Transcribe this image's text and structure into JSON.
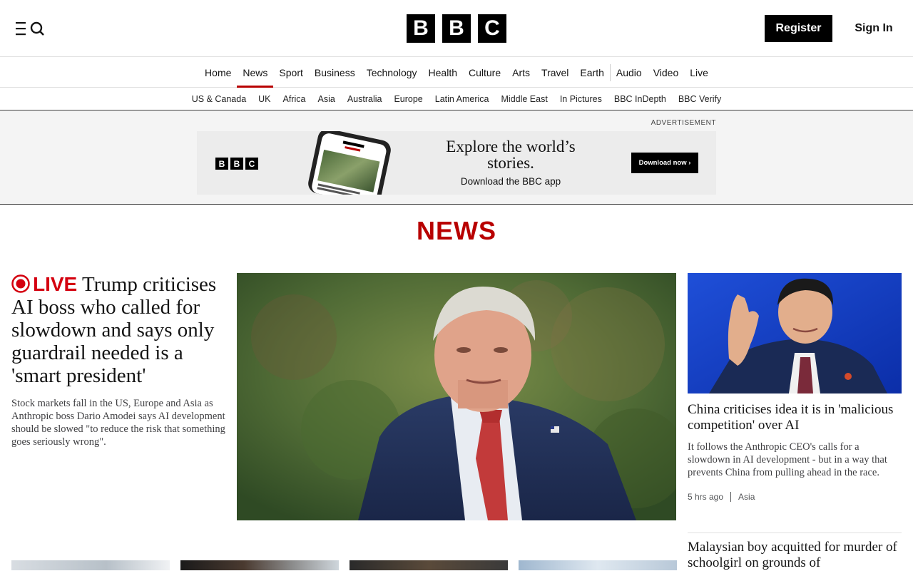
{
  "header": {
    "logo_letters": [
      "B",
      "B",
      "C"
    ],
    "register_label": "Register",
    "signin_label": "Sign In"
  },
  "main_nav": [
    {
      "label": "Home"
    },
    {
      "label": "News",
      "active": true
    },
    {
      "label": "Sport"
    },
    {
      "label": "Business"
    },
    {
      "label": "Technology"
    },
    {
      "label": "Health"
    },
    {
      "label": "Culture"
    },
    {
      "label": "Arts"
    },
    {
      "label": "Travel"
    },
    {
      "label": "Earth"
    },
    {
      "label": "Audio"
    },
    {
      "label": "Video"
    },
    {
      "label": "Live"
    }
  ],
  "sub_nav": [
    "US & Canada",
    "UK",
    "Africa",
    "Asia",
    "Australia",
    "Europe",
    "Latin America",
    "Middle East",
    "In Pictures",
    "BBC InDepth",
    "BBC Verify"
  ],
  "advert": {
    "label": "ADVERTISEMENT",
    "headline": "Explore the world’s stories.",
    "subline": "Download the BBC app",
    "button": "Download now ›"
  },
  "section_title": "NEWS",
  "lead_story": {
    "live_label": "LIVE",
    "title": "Trump criticises AI boss who called for slowdown and says only guardrail needed is a 'smart president'",
    "summary": "Stock markets fall in the US, Europe and Asia as Anthropic boss Dario Amodei says AI development should be slowed \"to reduce the risk that something goes seriously wrong\"."
  },
  "right_story": {
    "title": "China criticises idea it is in 'malicious competition' over AI",
    "summary": "It follows the Anthropic CEO's calls for a slowdown in AI development - but in a way that prevents China from pulling ahead in the race.",
    "time": "5 hrs ago",
    "tag": "Asia"
  },
  "second_story": {
    "title": "Malaysian boy acquitted for murder of schoolgirl on grounds of"
  },
  "colors": {
    "brand_red": "#b80000",
    "live_red": "#d4000f"
  }
}
